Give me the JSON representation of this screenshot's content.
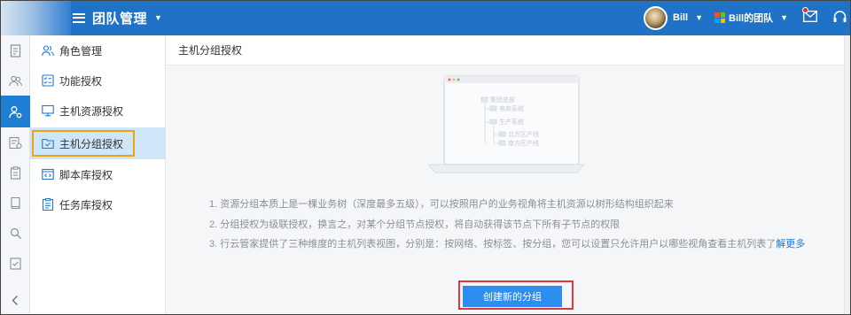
{
  "header": {
    "menu_title": "团队管理",
    "user_name": "Bill",
    "team_name": "Bill的团队",
    "icons": [
      "menu-icon",
      "chevron-down-icon",
      "microsoft-logo-icon",
      "mail-icon",
      "headset-icon"
    ]
  },
  "rail": {
    "items": [
      "document-icon",
      "users-icon",
      "user-settings-icon",
      "server-settings-icon",
      "clipboard-icon",
      "book-icon",
      "search-icon",
      "checklist-icon",
      "collapse-left-icon"
    ],
    "active_index": 2
  },
  "sidebar": {
    "items": [
      {
        "label": "角色管理",
        "icon": "users-icon"
      },
      {
        "label": "功能授权",
        "icon": "checklist-icon"
      },
      {
        "label": "主机资源授权",
        "icon": "monitor-icon"
      },
      {
        "label": "主机分组授权",
        "icon": "folder-icon"
      },
      {
        "label": "脚本库授权",
        "icon": "code-file-icon"
      },
      {
        "label": "任务库授权",
        "icon": "task-list-icon"
      }
    ],
    "active_index": 3
  },
  "main": {
    "title": "主机分组授权",
    "illustration": {
      "tree": [
        "集团总部",
        "电商系统",
        "生产系统",
        "北方区产线",
        "南方区产线"
      ]
    },
    "tips": [
      "1. 资源分组本质上是一棵业务树（深度最多五级），可以按照用户的业务视角将主机资源以树形结构组织起来",
      "2. 分组授权为级联授权，换言之，对某个分组节点授权，将自动获得该节点下所有子节点的权限",
      "3. 行云管家提供了三种维度的主机列表视图，分别是：按网络、按标签、按分组，您可以设置只允许用户以哪些视角查看主机列表了"
    ],
    "learn_more": "解更多",
    "create_button": "创建新的分组"
  },
  "colors": {
    "topbar": "#1f72c6",
    "rail_active": "#1e7ed3",
    "sidebar_active": "#cfe6f8",
    "highlight_orange": "#f2a20f",
    "highlight_red": "#e0353f",
    "button": "#2d8ef0",
    "link": "#1f78d1"
  }
}
